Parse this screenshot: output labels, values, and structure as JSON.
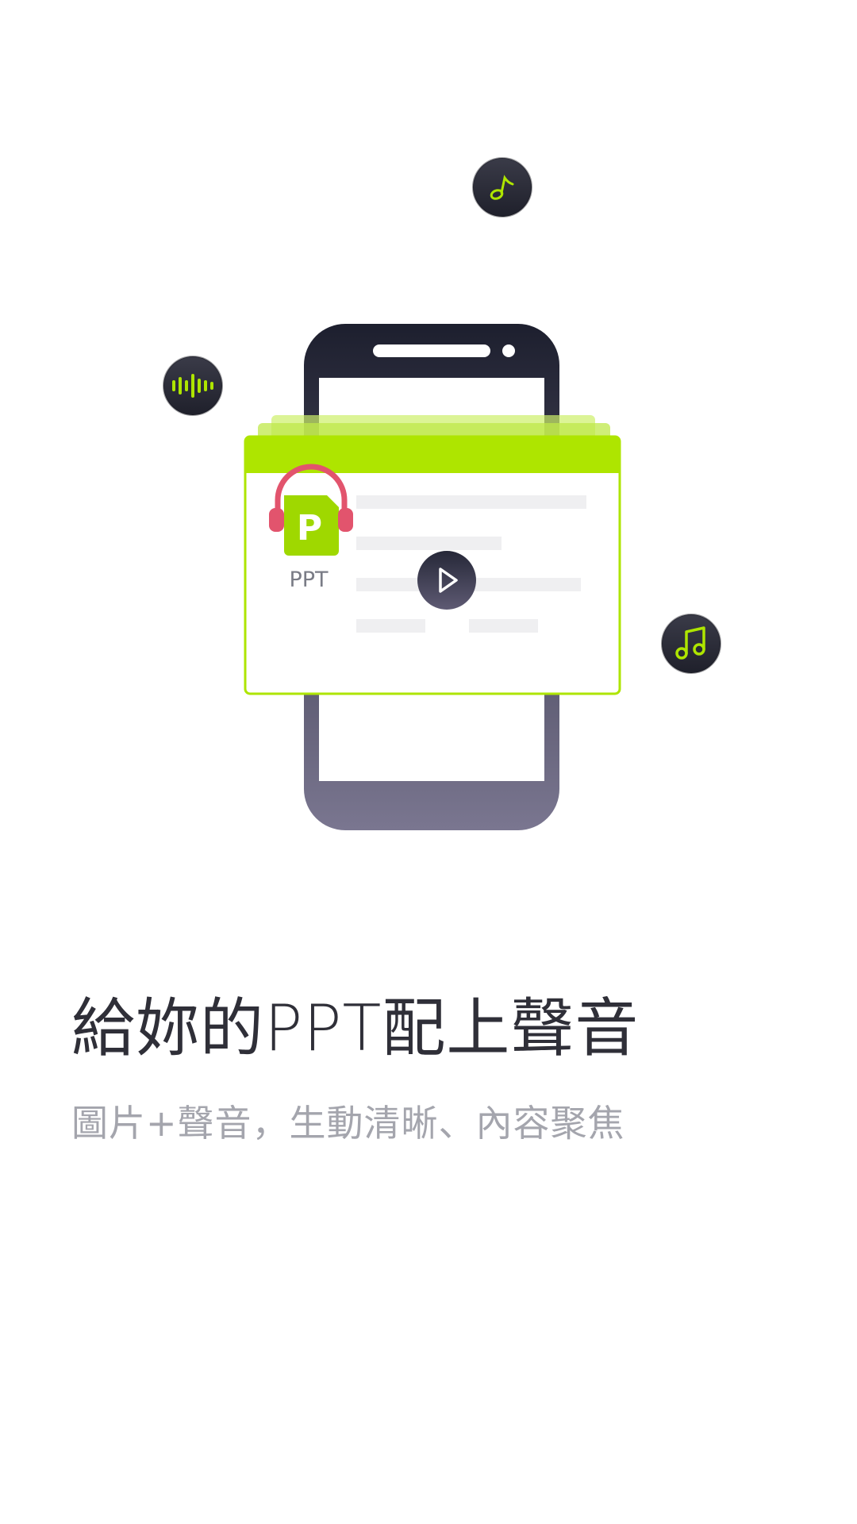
{
  "illustration": {
    "icon_badge_label": "PPT",
    "icon_letter": "P",
    "colors": {
      "phone_top": "#1d1f2e",
      "phone_bottom": "#7a7690",
      "accent_green": "#aee500",
      "headphone_pink": "#e2546d",
      "placeholder_line": "#efeff1",
      "badge_dark": "#2b2c38"
    },
    "floating_icons": [
      "music-note-icon",
      "sound-wave-icon",
      "music-notes-icon"
    ]
  },
  "headline": "給妳的PPT配上聲音",
  "subheadline": "圖片+聲音，生動清晰、內容聚焦"
}
